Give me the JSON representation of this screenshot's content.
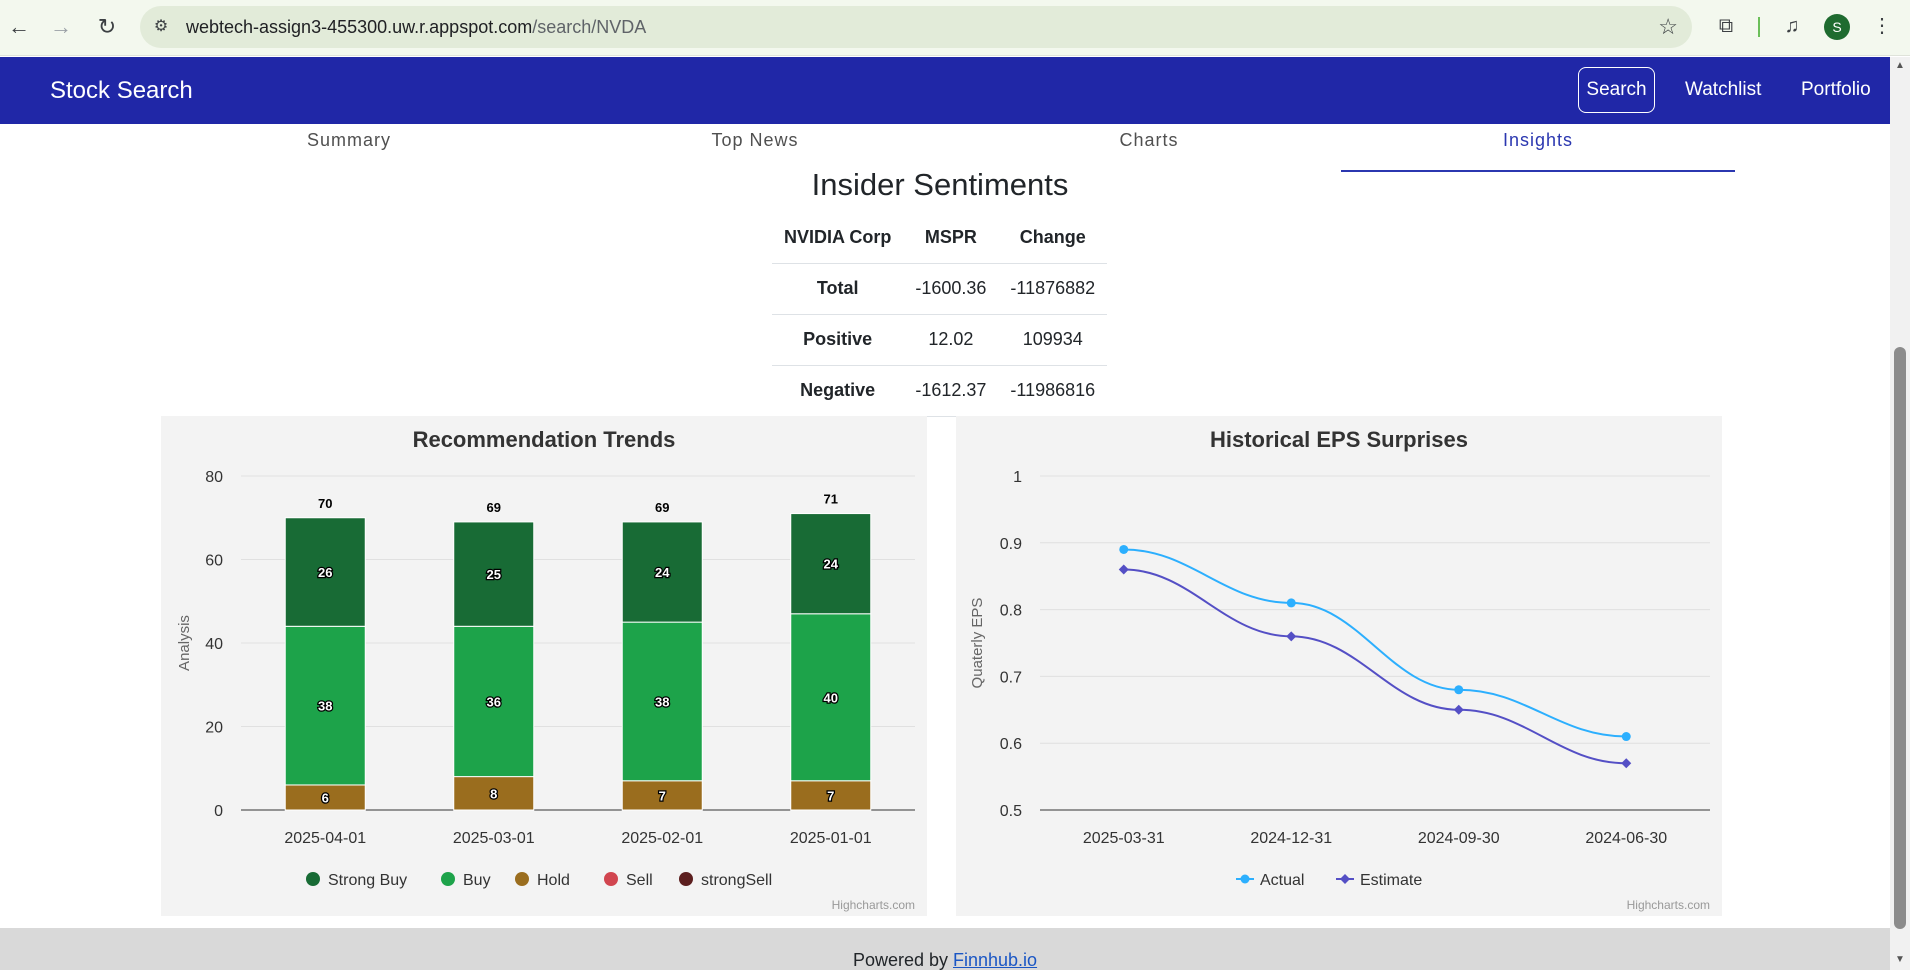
{
  "browser": {
    "url_host": "webtech-assign3-455300.uw.r.appspot.com",
    "url_path": "/search/NVDA",
    "avatar_letter": "S"
  },
  "navbar": {
    "brand": "Stock Search",
    "links": [
      "Search",
      "Watchlist",
      "Portfolio"
    ],
    "bg_color": "#2027a7"
  },
  "tabs": [
    "Summary",
    "Top News",
    "Charts",
    "Insights"
  ],
  "active_tab": "Insights",
  "insider": {
    "title": "Insider Sentiments",
    "headers": [
      "NVIDIA Corp",
      "MSPR",
      "Change"
    ],
    "rows": [
      {
        "label": "Total",
        "mspr": "-1600.36",
        "change": "-11876882"
      },
      {
        "label": "Positive",
        "mspr": "12.02",
        "change": "109934"
      },
      {
        "label": "Negative",
        "mspr": "-1612.37",
        "change": "-11986816"
      }
    ]
  },
  "chart_data": [
    {
      "type": "bar",
      "stacked": true,
      "title": "Recommendation Trends",
      "ylabel": "Analysis",
      "xlabel": "",
      "ylim": [
        0,
        80
      ],
      "yticks": [
        0,
        20,
        40,
        60,
        80
      ],
      "categories": [
        "2025-04-01",
        "2025-03-01",
        "2025-02-01",
        "2025-01-01"
      ],
      "series": [
        {
          "name": "Strong Buy",
          "color": "#186b35",
          "values": [
            26,
            25,
            24,
            24
          ]
        },
        {
          "name": "Buy",
          "color": "#1da34a",
          "values": [
            38,
            36,
            38,
            40
          ]
        },
        {
          "name": "Hold",
          "color": "#9a6d1e",
          "values": [
            6,
            8,
            7,
            7
          ]
        },
        {
          "name": "Sell",
          "color": "#d1454f",
          "values": [
            0,
            0,
            0,
            0
          ]
        },
        {
          "name": "strongSell",
          "color": "#5c1f1f",
          "values": [
            0,
            0,
            0,
            0
          ]
        }
      ],
      "totals": [
        70,
        69,
        69,
        71
      ],
      "grid": true,
      "legend": "bottom",
      "credit": "Highcharts.com"
    },
    {
      "type": "line",
      "title": "Historical EPS Surprises",
      "ylabel": "Quaterly EPS",
      "xlabel": "",
      "ylim": [
        0.5,
        1
      ],
      "yticks": [
        "0.5",
        "0.6",
        "0.7",
        "0.8",
        "0.9",
        "1"
      ],
      "categories": [
        "2025-03-31",
        "2024-12-31",
        "2024-09-30",
        "2024-06-30"
      ],
      "series": [
        {
          "name": "Actual",
          "color": "#2caffe",
          "marker": "circle",
          "values": [
            0.89,
            0.81,
            0.68,
            0.61
          ]
        },
        {
          "name": "Estimate",
          "color": "#544fc5",
          "marker": "diamond",
          "values": [
            0.86,
            0.76,
            0.65,
            0.57
          ]
        }
      ],
      "grid": true,
      "legend": "bottom",
      "credit": "Highcharts.com"
    }
  ],
  "footer": {
    "prefix": "Powered by ",
    "link": "Finnhub.io"
  }
}
